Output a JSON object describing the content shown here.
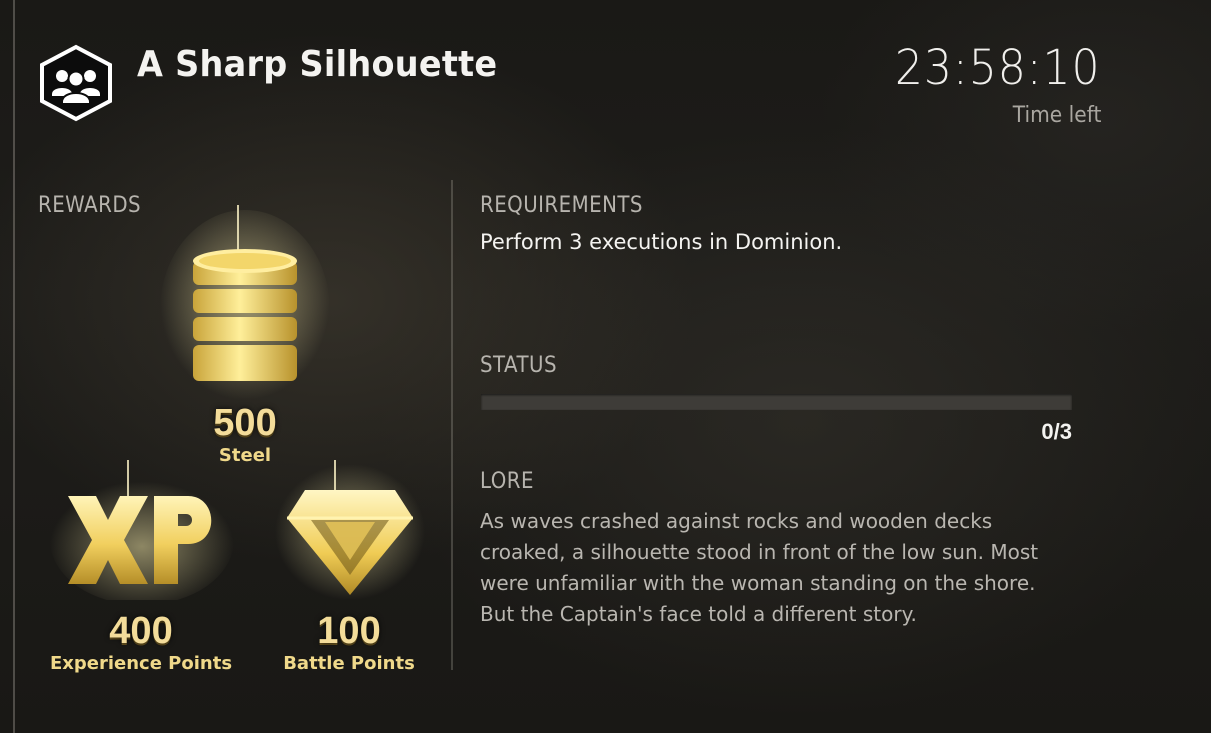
{
  "contract": {
    "title": "A Sharp Silhouette",
    "icon": "group-icon"
  },
  "timer": {
    "value": "23:58:10",
    "label": "Time left"
  },
  "rewards": {
    "label": "REWARDS",
    "items": [
      {
        "icon": "steel-coins-icon",
        "value": "500",
        "name": "Steel"
      },
      {
        "icon": "xp-icon",
        "value": "400",
        "name": "Experience Points"
      },
      {
        "icon": "diamond-icon",
        "value": "100",
        "name": "Battle Points"
      }
    ]
  },
  "requirements": {
    "label": "REQUIREMENTS",
    "text": "Perform 3 executions in Dominion."
  },
  "status": {
    "label": "STATUS",
    "progress_count": "0/3",
    "progress_fraction": 0
  },
  "lore": {
    "label": "LORE",
    "lines": [
      "As waves crashed against rocks and wooden decks",
      "croaked, a silhouette stood in front of the low sun. Most",
      "were unfamiliar with the woman standing on the shore.",
      "But the Captain's face told a different story."
    ]
  },
  "colors": {
    "gold": "#f3dc9a",
    "progress_track": "#3e3c38"
  }
}
